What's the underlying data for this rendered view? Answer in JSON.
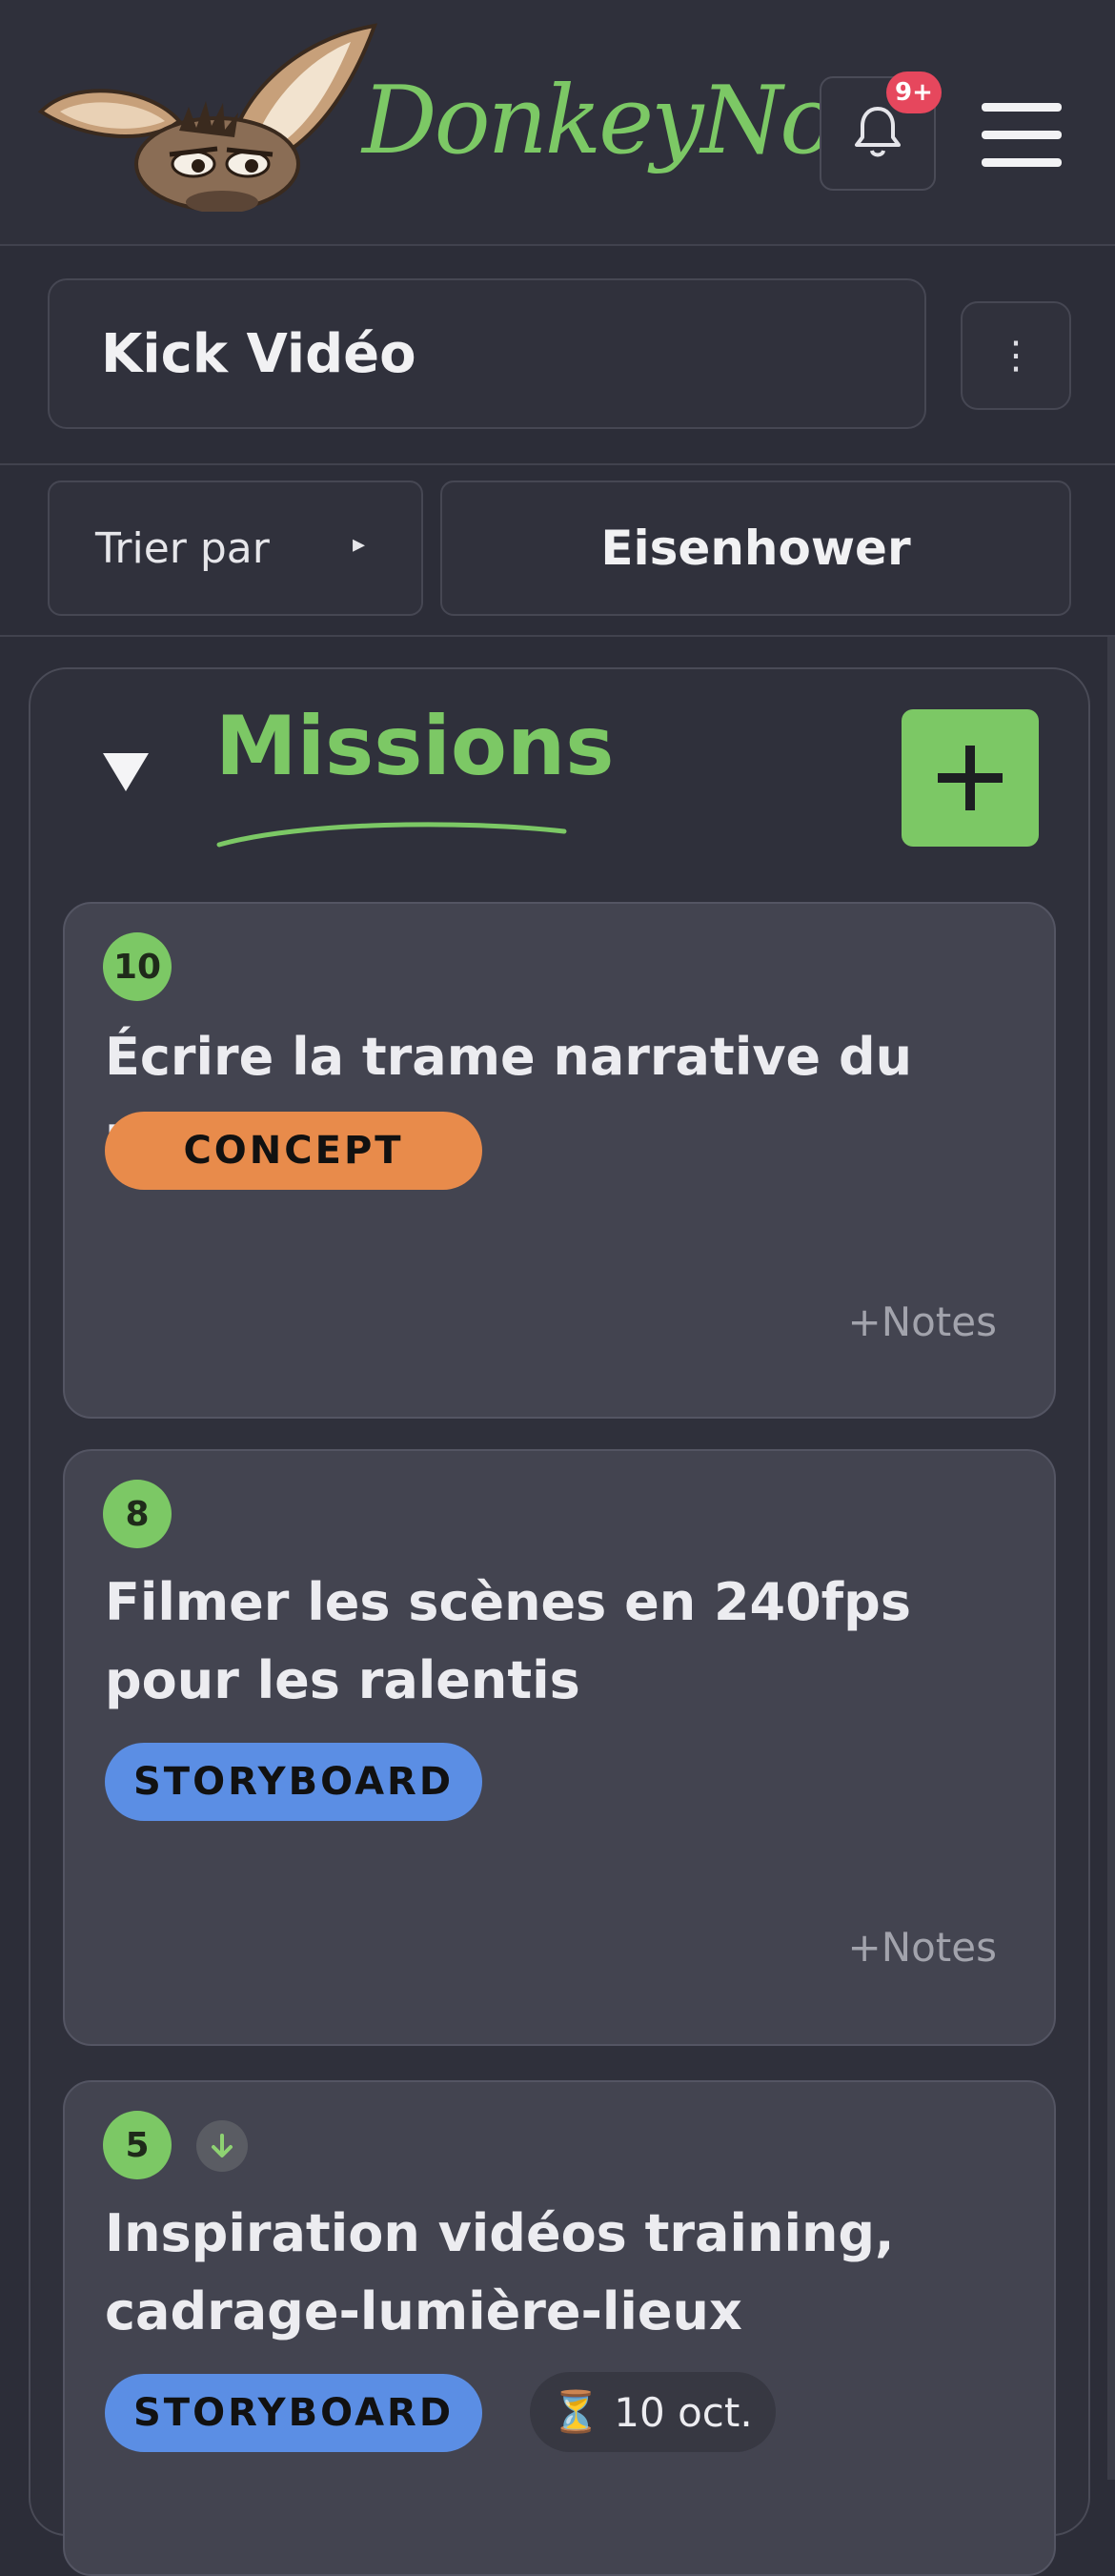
{
  "header": {
    "brand": "DonkeyNote",
    "notification_count": "9+"
  },
  "project": {
    "name": "Kick Vidéo",
    "menu_icon": "⋮"
  },
  "sort": {
    "label": "Trier par",
    "arrow": "▸",
    "mode": "Eisenhower"
  },
  "missions": {
    "title": "Missions",
    "cards": [
      {
        "number": "10",
        "title": "Écrire la trame narrative du projet",
        "tag": "CONCEPT",
        "tag_color": "#e88b4b",
        "notes": "+Notes"
      },
      {
        "number": "8",
        "title": "Filmer les scènes en 240fps pour les ralentis",
        "tag": "STORYBOARD",
        "tag_color": "#5b8ee4",
        "notes": "+Notes"
      },
      {
        "number": "5",
        "title": "Inspiration vidéos training, cadrage-lumière-lieux",
        "tag": "STORYBOARD",
        "tag_color": "#5b8ee4",
        "due_icon": "⏳",
        "due": "10 oct.",
        "priority_icon": "arrow-down-icon"
      }
    ]
  },
  "colors": {
    "accent": "#7cc865",
    "badge": "#e6475d",
    "background": "#2c2d38",
    "card": "#434450"
  }
}
